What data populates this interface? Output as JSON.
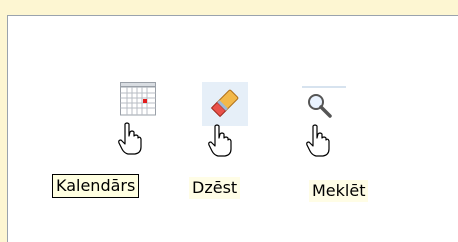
{
  "toolbar": {
    "items": [
      {
        "id": "calendar",
        "label": "Kalendārs",
        "icon": "calendar-icon",
        "state": "tooltip"
      },
      {
        "id": "delete",
        "label": "Dzēst",
        "icon": "eraser-icon",
        "state": "hover"
      },
      {
        "id": "search",
        "label": "Meklēt",
        "icon": "magnifier-icon",
        "state": "normal"
      }
    ]
  },
  "colors": {
    "page_bg": "#fdf6d2",
    "panel_bg": "#ffffff",
    "hover_bg": "#e6eff8",
    "tooltip_bg": "#ffffe1",
    "label_bg": "#fffde6"
  },
  "cursor": {
    "icon": "hand-pointer-icon"
  }
}
